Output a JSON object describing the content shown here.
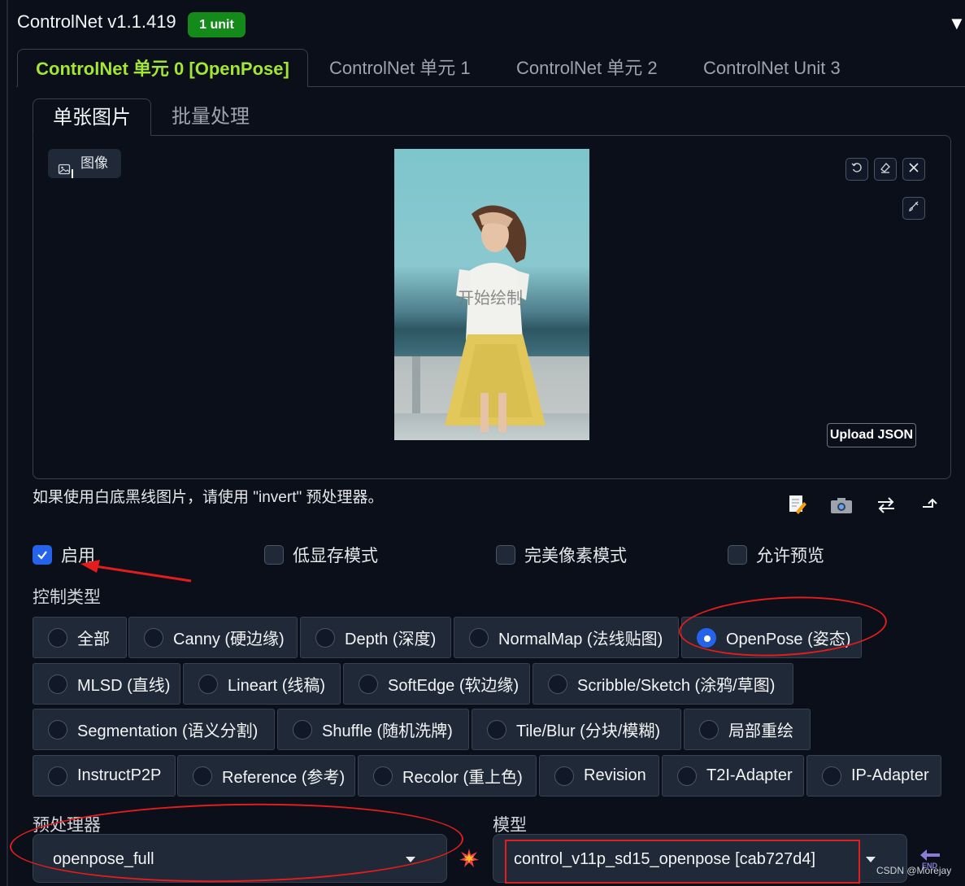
{
  "header": {
    "title": "ControlNet v1.1.419",
    "badge": "1 unit",
    "collapse_glyph": "▼"
  },
  "unit_tabs": [
    {
      "label": "ControlNet 单元 0 [OpenPose]",
      "active": true
    },
    {
      "label": "ControlNet 单元 1",
      "active": false
    },
    {
      "label": "ControlNet 单元 2",
      "active": false
    },
    {
      "label": "ControlNet Unit 3",
      "active": false
    }
  ],
  "sub_tabs": [
    {
      "label": "单张图片",
      "active": true
    },
    {
      "label": "批量处理",
      "active": false
    }
  ],
  "canvas": {
    "image_label": "图像",
    "overlay_hint": "开始绘制",
    "upload_json": "Upload JSON",
    "tool_icons": [
      "undo-icon",
      "eraser-icon",
      "close-icon",
      "brush-icon"
    ]
  },
  "note": "如果使用白底黑线图片，请使用 \"invert\" 预处理器。",
  "action_icons": [
    "edit-icon",
    "camera-icon",
    "swap-icon",
    "send-dimensions-icon"
  ],
  "checkboxes": [
    {
      "label": "启用",
      "checked": true
    },
    {
      "label": "低显存模式",
      "checked": false
    },
    {
      "label": "完美像素模式",
      "checked": false
    },
    {
      "label": "允许预览",
      "checked": false
    }
  ],
  "control_type": {
    "label": "控制类型",
    "options": [
      {
        "label": "全部",
        "selected": false
      },
      {
        "label": "Canny (硬边缘)",
        "selected": false
      },
      {
        "label": "Depth (深度)",
        "selected": false
      },
      {
        "label": "NormalMap (法线贴图)",
        "selected": false
      },
      {
        "label": "OpenPose (姿态)",
        "selected": true
      },
      {
        "label": "MLSD (直线)",
        "selected": false
      },
      {
        "label": "Lineart (线稿)",
        "selected": false
      },
      {
        "label": "SoftEdge (软边缘)",
        "selected": false
      },
      {
        "label": "Scribble/Sketch (涂鸦/草图)",
        "selected": false
      },
      {
        "label": "Segmentation (语义分割)",
        "selected": false
      },
      {
        "label": "Shuffle (随机洗牌)",
        "selected": false
      },
      {
        "label": "Tile/Blur (分块/模糊)",
        "selected": false
      },
      {
        "label": "局部重绘",
        "selected": false
      },
      {
        "label": "InstructP2P",
        "selected": false
      },
      {
        "label": "Reference (参考)",
        "selected": false
      },
      {
        "label": "Recolor (重上色)",
        "selected": false
      },
      {
        "label": "Revision",
        "selected": false
      },
      {
        "label": "T2I-Adapter",
        "selected": false
      },
      {
        "label": "IP-Adapter",
        "selected": false
      }
    ]
  },
  "preprocessor": {
    "label": "预处理器",
    "value": "openpose_full"
  },
  "model": {
    "label": "模型",
    "value": "control_v11p_sd15_openpose [cab727d4]"
  },
  "run_preprocessor_icon": "explosion-icon",
  "refresh_icon": "back-arrow-icon",
  "refresh_label": "END",
  "watermark": "CSDN @Morejay",
  "colors": {
    "accent_green": "#a3e635",
    "badge_green": "#148a1a",
    "selected_blue": "#2563eb",
    "annotation_red": "#e11d1d",
    "background": "#0b0f19"
  }
}
